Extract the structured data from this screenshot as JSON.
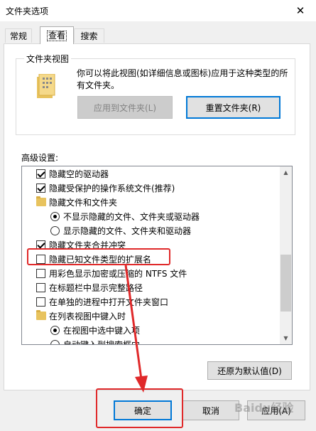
{
  "window": {
    "title": "文件夹选项",
    "close_glyph": "✕"
  },
  "tabs": [
    {
      "label": "常规",
      "active": false
    },
    {
      "label": "查看",
      "active": true
    },
    {
      "label": "搜索",
      "active": false
    }
  ],
  "folder_view": {
    "legend": "文件夹视图",
    "description": "你可以将此视图(如详细信息或图标)应用于这种类型的所有文件夹。",
    "apply_button": "应用到文件夹(L)",
    "reset_button": "重置文件夹(R)"
  },
  "advanced": {
    "label": "高级设置:",
    "items": [
      {
        "kind": "checkbox",
        "checked": true,
        "label": "隐藏空的驱动器",
        "indent": 1
      },
      {
        "kind": "checkbox",
        "checked": true,
        "label": "隐藏受保护的操作系统文件(推荐)",
        "indent": 1
      },
      {
        "kind": "folder",
        "label": "隐藏文件和文件夹",
        "indent": 1
      },
      {
        "kind": "radio",
        "checked": true,
        "label": "不显示隐藏的文件、文件夹或驱动器",
        "indent": 2
      },
      {
        "kind": "radio",
        "checked": false,
        "label": "显示隐藏的文件、文件夹和驱动器",
        "indent": 2
      },
      {
        "kind": "checkbox",
        "checked": true,
        "label": "隐藏文件夹合并冲突",
        "indent": 1
      },
      {
        "kind": "checkbox",
        "checked": false,
        "label": "隐藏已知文件类型的扩展名",
        "indent": 1
      },
      {
        "kind": "checkbox",
        "checked": false,
        "label": "用彩色显示加密或压缩的 NTFS 文件",
        "indent": 1
      },
      {
        "kind": "checkbox",
        "checked": false,
        "label": "在标题栏中显示完整路径",
        "indent": 1
      },
      {
        "kind": "checkbox",
        "checked": false,
        "label": "在单独的进程中打开文件夹窗口",
        "indent": 1
      },
      {
        "kind": "folder",
        "label": "在列表视图中键入时",
        "indent": 1
      },
      {
        "kind": "radio",
        "checked": true,
        "label": "在视图中选中键入项",
        "indent": 2
      },
      {
        "kind": "radio",
        "checked": false,
        "label": "自动键入到搜索框中",
        "indent": 2
      }
    ],
    "restore_button": "还原为默认值(D)"
  },
  "footer": {
    "ok_button": "确定",
    "cancel_button": "取消",
    "apply_button": "应用(A)"
  },
  "watermark": "Baidu经验",
  "annotation_colors": {
    "highlight": "#e0292a"
  }
}
